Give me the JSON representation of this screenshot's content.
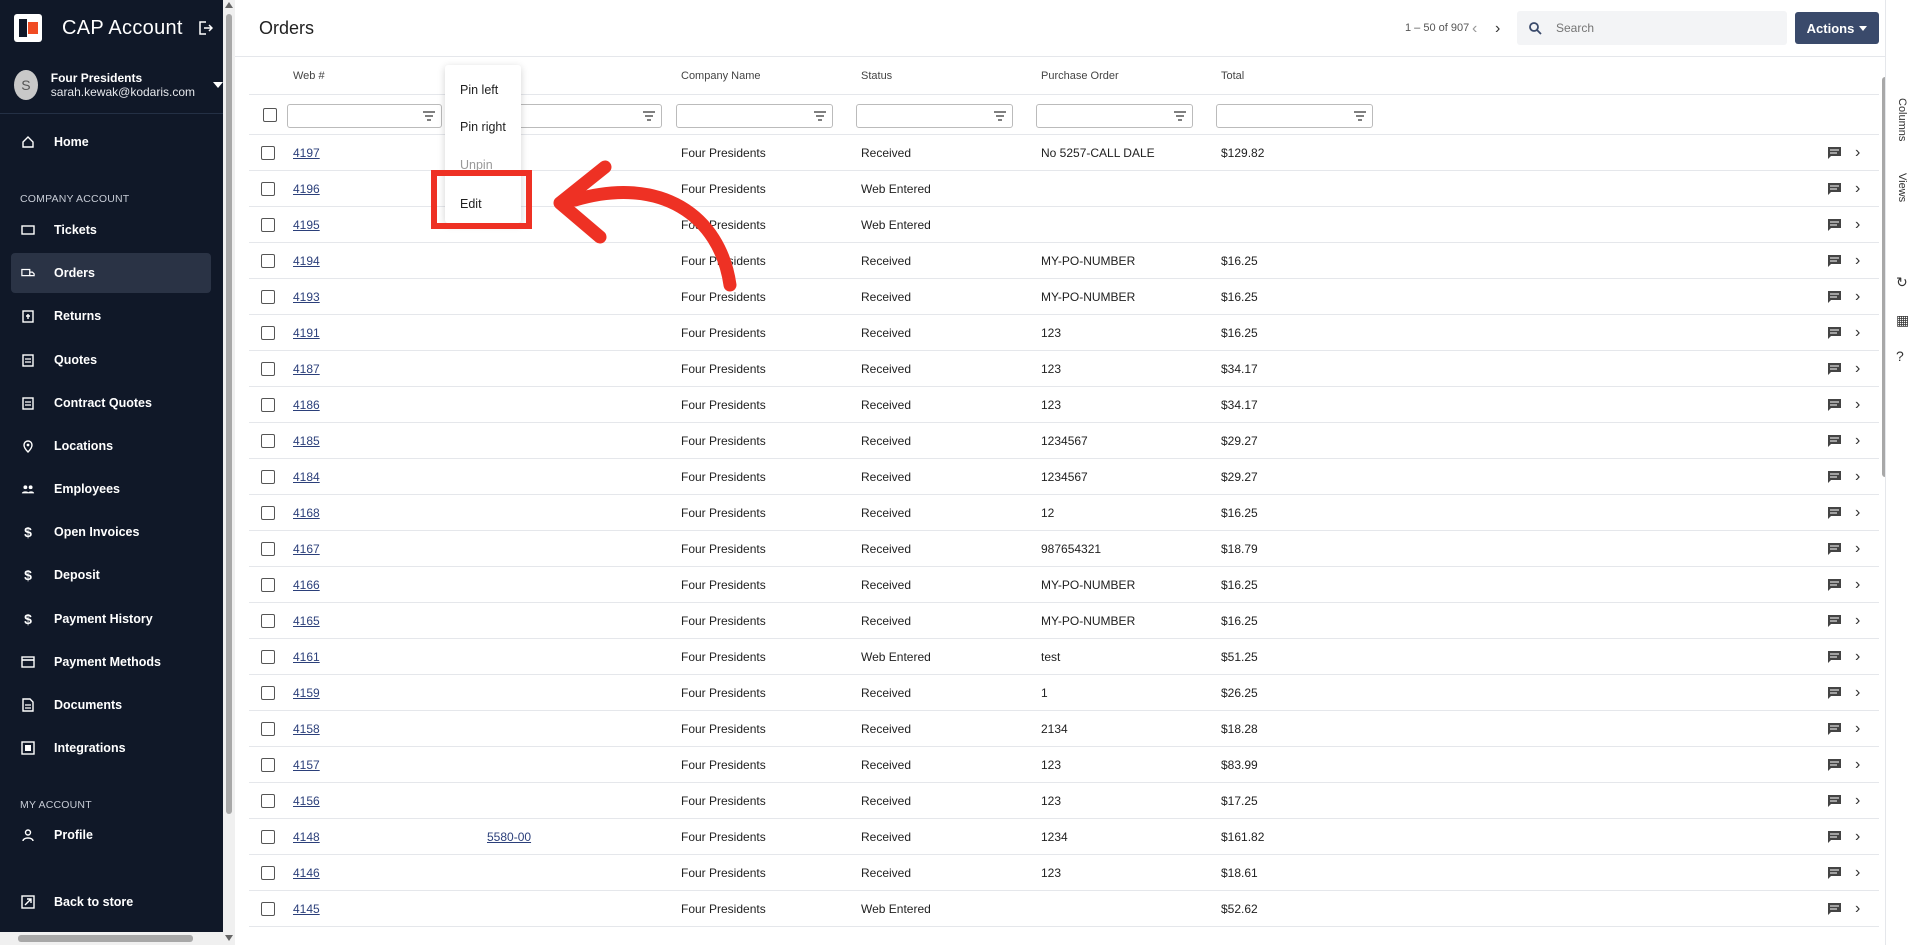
{
  "app": {
    "title": "CAP Account"
  },
  "user": {
    "initial": "S",
    "name": "Four Presidents",
    "email": "sarah.kewak@kodaris.com"
  },
  "sidebar": {
    "home": "Home",
    "section_company": "COMPANY ACCOUNT",
    "items": [
      "Tickets",
      "Orders",
      "Returns",
      "Quotes",
      "Contract Quotes",
      "Locations",
      "Employees",
      "Open Invoices",
      "Deposit",
      "Payment History",
      "Payment Methods",
      "Documents",
      "Integrations"
    ],
    "section_my": "MY ACCOUNT",
    "profile": "Profile",
    "back": "Back to store",
    "active": "Orders"
  },
  "page": {
    "title": "Orders",
    "pager": "1 – 50 of 907",
    "search_placeholder": "Search",
    "actions_label": "Actions"
  },
  "columns": [
    "Web #",
    "Company Name",
    "Status",
    "Purchase Order",
    "Total"
  ],
  "menu": {
    "pin_left": "Pin left",
    "pin_right": "Pin right",
    "unpin": "Unpin",
    "edit": "Edit"
  },
  "rail": {
    "columns": "Columns",
    "views": "Views"
  },
  "rows": [
    {
      "web": "4197",
      "extra": "",
      "company": "Four Presidents",
      "status": "Received",
      "po": "No 5257-CALL DALE",
      "total": "$129.82"
    },
    {
      "web": "4196",
      "extra": "",
      "company": "Four Presidents",
      "status": "Web Entered",
      "po": "",
      "total": ""
    },
    {
      "web": "4195",
      "extra": "",
      "company": "Four Presidents",
      "status": "Web Entered",
      "po": "",
      "total": ""
    },
    {
      "web": "4194",
      "extra": "",
      "company": "Four Presidents",
      "status": "Received",
      "po": "MY-PO-NUMBER",
      "total": "$16.25"
    },
    {
      "web": "4193",
      "extra": "",
      "company": "Four Presidents",
      "status": "Received",
      "po": "MY-PO-NUMBER",
      "total": "$16.25"
    },
    {
      "web": "4191",
      "extra": "",
      "company": "Four Presidents",
      "status": "Received",
      "po": "123",
      "total": "$16.25"
    },
    {
      "web": "4187",
      "extra": "",
      "company": "Four Presidents",
      "status": "Received",
      "po": "123",
      "total": "$34.17"
    },
    {
      "web": "4186",
      "extra": "",
      "company": "Four Presidents",
      "status": "Received",
      "po": "123",
      "total": "$34.17"
    },
    {
      "web": "4185",
      "extra": "",
      "company": "Four Presidents",
      "status": "Received",
      "po": "1234567",
      "total": "$29.27"
    },
    {
      "web": "4184",
      "extra": "",
      "company": "Four Presidents",
      "status": "Received",
      "po": "1234567",
      "total": "$29.27"
    },
    {
      "web": "4168",
      "extra": "",
      "company": "Four Presidents",
      "status": "Received",
      "po": "12",
      "total": "$16.25"
    },
    {
      "web": "4167",
      "extra": "",
      "company": "Four Presidents",
      "status": "Received",
      "po": "987654321",
      "total": "$18.79"
    },
    {
      "web": "4166",
      "extra": "",
      "company": "Four Presidents",
      "status": "Received",
      "po": "MY-PO-NUMBER",
      "total": "$16.25"
    },
    {
      "web": "4165",
      "extra": "",
      "company": "Four Presidents",
      "status": "Received",
      "po": "MY-PO-NUMBER",
      "total": "$16.25"
    },
    {
      "web": "4161",
      "extra": "",
      "company": "Four Presidents",
      "status": "Web Entered",
      "po": "test",
      "total": "$51.25"
    },
    {
      "web": "4159",
      "extra": "",
      "company": "Four Presidents",
      "status": "Received",
      "po": "1",
      "total": "$26.25"
    },
    {
      "web": "4158",
      "extra": "",
      "company": "Four Presidents",
      "status": "Received",
      "po": "2134",
      "total": "$18.28"
    },
    {
      "web": "4157",
      "extra": "",
      "company": "Four Presidents",
      "status": "Received",
      "po": "123",
      "total": "$83.99"
    },
    {
      "web": "4156",
      "extra": "",
      "company": "Four Presidents",
      "status": "Received",
      "po": "123",
      "total": "$17.25"
    },
    {
      "web": "4148",
      "extra": "5580-00",
      "company": "Four Presidents",
      "status": "Received",
      "po": "1234",
      "total": "$161.82"
    },
    {
      "web": "4146",
      "extra": "",
      "company": "Four Presidents",
      "status": "Received",
      "po": "123",
      "total": "$18.61"
    },
    {
      "web": "4145",
      "extra": "",
      "company": "Four Presidents",
      "status": "Web Entered",
      "po": "",
      "total": "$52.62"
    }
  ],
  "colors": {
    "sidebar_bg": "#101828",
    "accent": "#3a4a6b",
    "annotation": "#ee3124"
  }
}
